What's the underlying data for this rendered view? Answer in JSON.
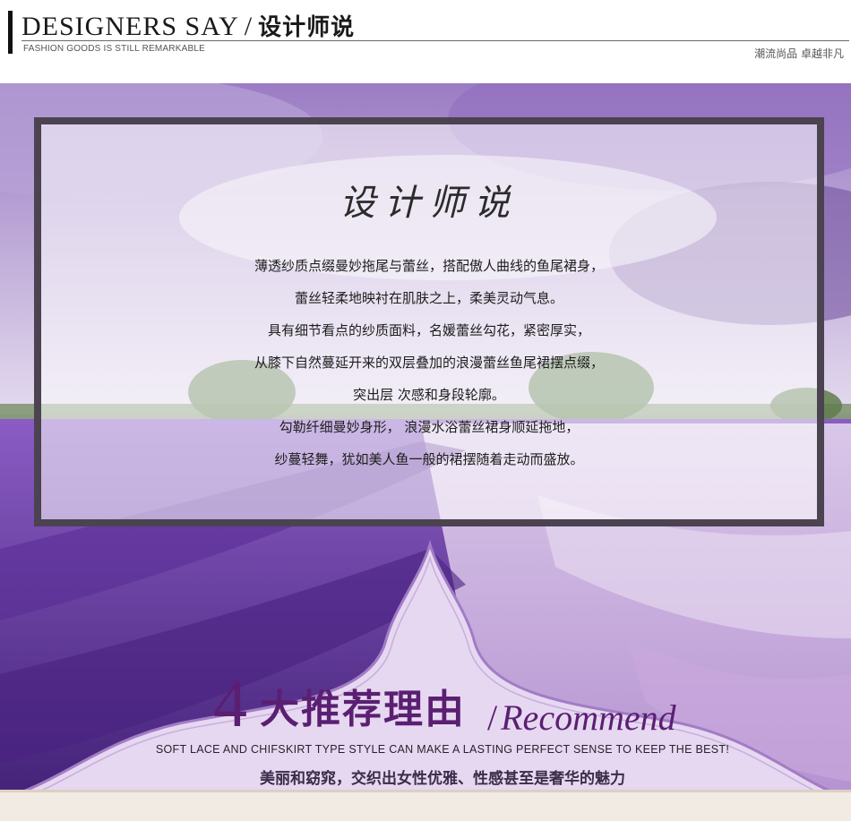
{
  "header": {
    "title_en": "DESIGNERS SAY",
    "slash": "/",
    "title_cn": "设计师说",
    "subtitle": "FASHION GOODS IS STILL REMARKABLE",
    "right_text": "潮流尚品 卓越非凡"
  },
  "designer": {
    "title": "设计师说",
    "lines": [
      "薄透纱质点缀曼妙拖尾与蕾丝，搭配傲人曲线的鱼尾裙身，",
      "蕾丝轻柔地映衬在肌肤之上，柔美灵动气息。",
      "具有细节看点的纱质面料，名媛蕾丝勾花，紧密厚实，",
      "从膝下自然蔓延开来的双层叠加的浪漫蕾丝鱼尾裙摆点缀，",
      "突出层 次感和身段轮廓。",
      "勾勒纤细曼妙身形， 浪漫水浴蕾丝裙身顺延拖地，",
      "纱蔓轻舞，犹如美人鱼一般的裙摆随着走动而盛放。"
    ]
  },
  "recommend": {
    "number": "4",
    "title_cn": "大推荐理由",
    "slash": "/",
    "title_en": "Recommend",
    "english_line": "SOFT LACE AND CHIFSKIRT TYPE STYLE CAN MAKE A LASTING PERFECT SENSE TO KEEP THE BEST!",
    "chinese_line": "美丽和窈窕，交织出女性优雅、性感甚至是奢华的魅力"
  },
  "colors": {
    "accent": "#5b1f72",
    "frame_border": "#4b4350",
    "lavender": "#7a3fb8"
  }
}
